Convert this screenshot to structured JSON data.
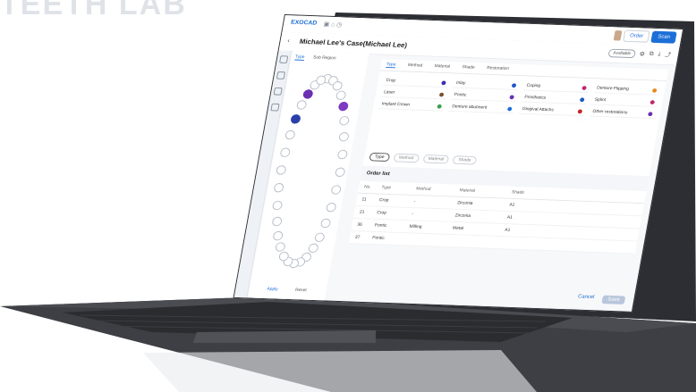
{
  "app": {
    "logo_text": "EXOCAD",
    "title": "Michael Lee's Case(Michael Lee)"
  },
  "topbar": {
    "order_label": "Order",
    "scan_label": "Scan",
    "pill_label": "Available"
  },
  "left_tabs": [
    "Type",
    "Sub Region"
  ],
  "type_tabs": [
    "Type",
    "Method",
    "Material",
    "Shade",
    "Restoration"
  ],
  "types": [
    {
      "label": "Crop",
      "color": "#3a2fb3"
    },
    {
      "label": "Inlay",
      "color": "#1d58c9"
    },
    {
      "label": "Coping",
      "color": "#c2256b"
    },
    {
      "label": "Denture Flipping",
      "color": "#e68a1c"
    },
    {
      "label": "Laser",
      "color": "#7c4e2a"
    },
    {
      "label": "Pontic",
      "color": "#6a2fb3"
    },
    {
      "label": "Prosthetics",
      "color": "#1d58c9"
    },
    {
      "label": "Splint",
      "color": "#c2256b"
    },
    {
      "label": "Implant Crown",
      "color": "#3aa04a"
    },
    {
      "label": "Denture abutment",
      "color": "#1d6fd8"
    },
    {
      "label": "Gingival Attachs",
      "color": "#c22525"
    },
    {
      "label": "Other restorations",
      "color": "#6a2fb3"
    }
  ],
  "filters": [
    "Type",
    "Method",
    "Material",
    "Shade"
  ],
  "order_title": "Order list",
  "order_columns": [
    "No.",
    "Type",
    "Method",
    "Material",
    "Shade"
  ],
  "order_rows": [
    {
      "no": "11",
      "type": "Crop",
      "method": "-",
      "material": "Zirconia",
      "shade": "A1"
    },
    {
      "no": "21",
      "type": "Crop",
      "method": "-",
      "material": "Zirconia",
      "shade": "A1"
    },
    {
      "no": "36",
      "type": "Pontic",
      "method": "Milling",
      "material": "Metal",
      "shade": "A1"
    },
    {
      "no": "37",
      "type": "Pontic",
      "method": "",
      "material": "",
      "shade": ""
    }
  ],
  "footer_left": [
    "Apply",
    "Reset"
  ],
  "actions": {
    "cancel": "Cancel",
    "save": "Save"
  }
}
